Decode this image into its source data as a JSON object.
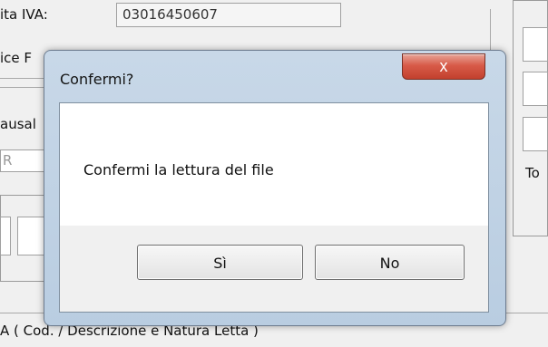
{
  "background": {
    "vat_label": "ita IVA:",
    "vat_value": "03016450607",
    "code_label": "ice F",
    "reason_label": "ausal",
    "reason_value": "R",
    "side_label": "To",
    "footer_text": "A ( Cod. / Descrizione e Natura Letta )"
  },
  "dialog": {
    "title": "Confermi?",
    "close_icon": "close-icon",
    "message": "Confermi la lettura del file",
    "buttons": {
      "yes": "Sì",
      "no": "No"
    }
  },
  "colors": {
    "dialog_frame": "#c4d6e8",
    "close_button": "#d85b49",
    "dialog_background": "#ffffff",
    "button_bar": "#f0f0f0"
  }
}
